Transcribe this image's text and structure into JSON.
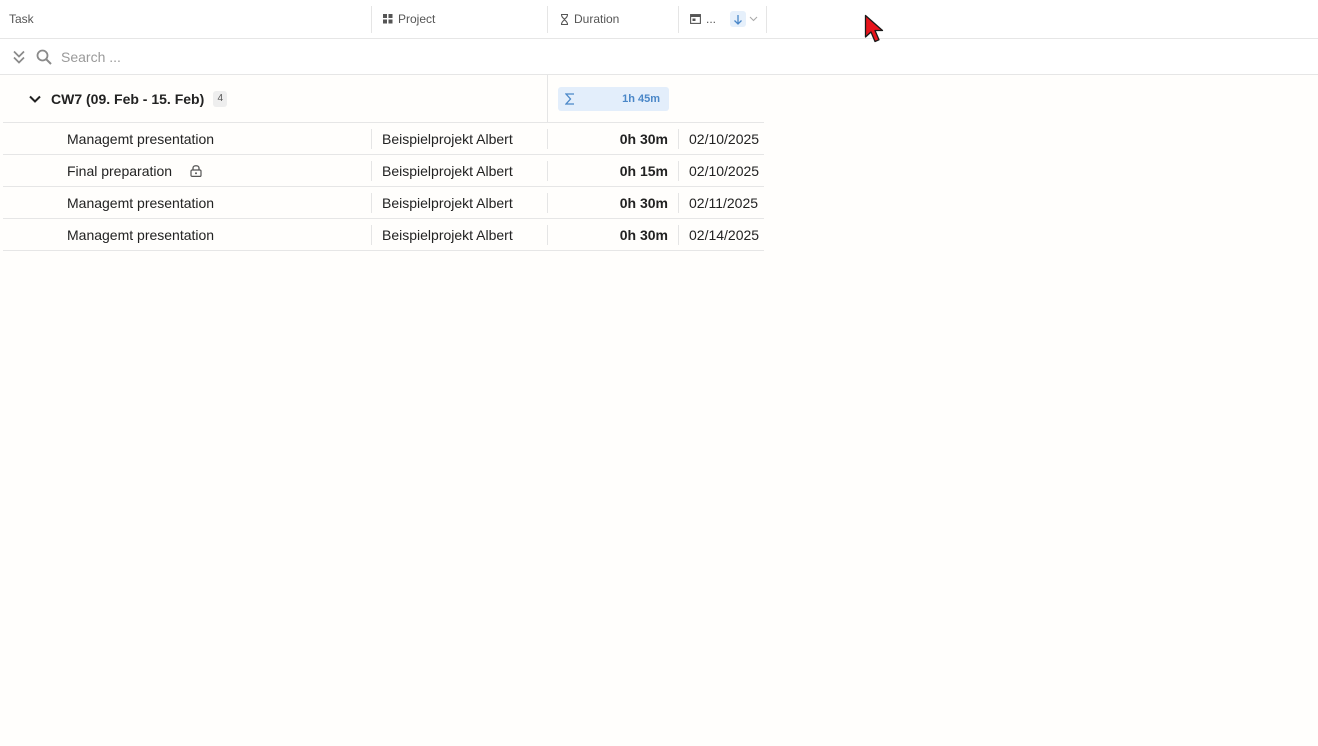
{
  "header": {
    "task_label": "Task",
    "project_label": "Project",
    "duration_label": "Duration",
    "date_label": "..."
  },
  "search": {
    "placeholder": "Search ..."
  },
  "group": {
    "title": "CW7 (09. Feb - 15. Feb)",
    "count": "4",
    "sum_duration": "1h 45m"
  },
  "rows": [
    {
      "task": "Managemt presentation",
      "project": "Beispielprojekt Albert",
      "duration": "0h 30m",
      "date": "02/10/2025",
      "locked": false
    },
    {
      "task": "Final preparation",
      "project": "Beispielprojekt Albert",
      "duration": "0h 15m",
      "date": "02/10/2025",
      "locked": true
    },
    {
      "task": "Managemt presentation",
      "project": "Beispielprojekt Albert",
      "duration": "0h 30m",
      "date": "02/11/2025",
      "locked": false
    },
    {
      "task": "Managemt presentation",
      "project": "Beispielprojekt Albert",
      "duration": "0h 30m",
      "date": "02/14/2025",
      "locked": false
    }
  ],
  "colors": {
    "accent": "#4a87c8",
    "sum_background": "#e3eefb",
    "cursor": "#e8141b"
  }
}
